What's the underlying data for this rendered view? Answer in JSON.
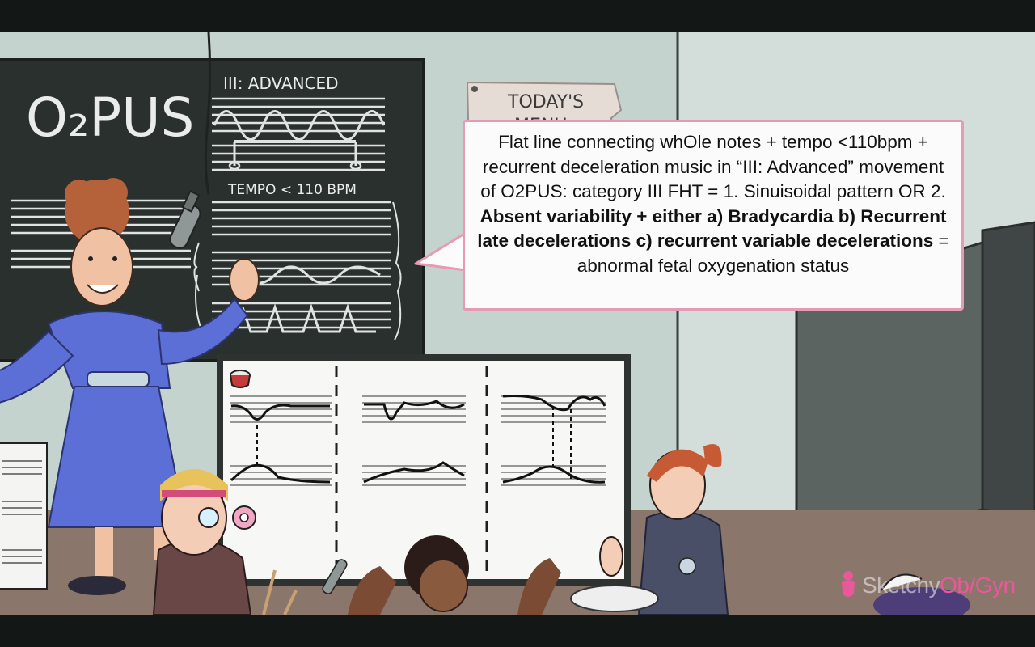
{
  "board": {
    "title": "O₂PUS",
    "movement_heading": "III: ADVANCED",
    "tempo_label": "TEMPO < 110 BPM"
  },
  "menu_sign": {
    "title": "TODAY'S",
    "subtitle": "MENU"
  },
  "callout": {
    "seg1": "Flat line connecting whOle notes + tempo <110bpm + recurrent deceleration music in “III: Advanced” movement of O2PUS: category III FHT = 1. Sinuisoidal pattern OR 2. ",
    "seg2": "Absent variability + either a) Bradycardia b) Recurrent late decelerations c) recurrent variable decelerations",
    "seg3": " = abnormal fetal oxygenation status"
  },
  "brand": {
    "part1": "Sketchy",
    "part2": "Ob/Gyn"
  },
  "colors": {
    "chalkboard": "#2a302e",
    "chalk": "#e9ecea",
    "wall": "#c9d6d2",
    "callout_border": "#e79ab5",
    "brand_pink": "#e8589a",
    "dress_blue": "#5b6fd6"
  }
}
